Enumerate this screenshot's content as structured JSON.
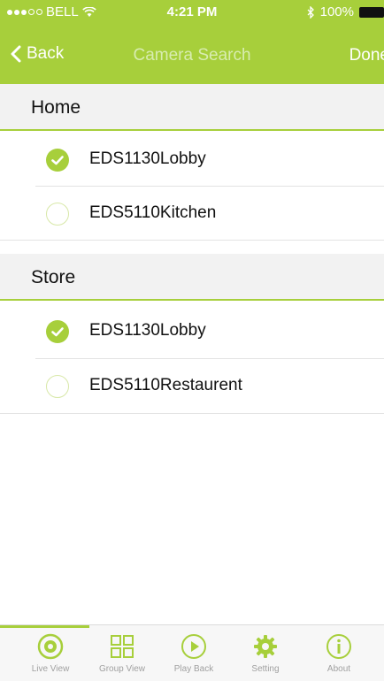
{
  "status": {
    "carrier": "BELL",
    "time": "4:21 PM",
    "battery": "100%"
  },
  "nav": {
    "back_label": "Back",
    "title": "Camera Search",
    "done_label": "Done"
  },
  "sections": [
    {
      "title": "Home",
      "items": [
        {
          "label": "EDS1130Lobby",
          "checked": true
        },
        {
          "label": "EDS5110Kitchen",
          "checked": false
        }
      ]
    },
    {
      "title": "Store",
      "items": [
        {
          "label": "EDS1130Lobby",
          "checked": true
        },
        {
          "label": "EDS5110Restaurent",
          "checked": false
        }
      ]
    }
  ],
  "tabs": [
    {
      "label": "Live View",
      "icon": "live-view-icon",
      "active": true
    },
    {
      "label": "Group View",
      "icon": "group-view-icon",
      "active": false
    },
    {
      "label": "Play Back",
      "icon": "play-back-icon",
      "active": false
    },
    {
      "label": "Setting",
      "icon": "gear-icon",
      "active": false
    },
    {
      "label": "About",
      "icon": "info-icon",
      "active": false
    }
  ],
  "colors": {
    "accent": "#a7cf3b",
    "accent_light": "#d8ecb0",
    "section_bg": "#f2f2f2"
  }
}
